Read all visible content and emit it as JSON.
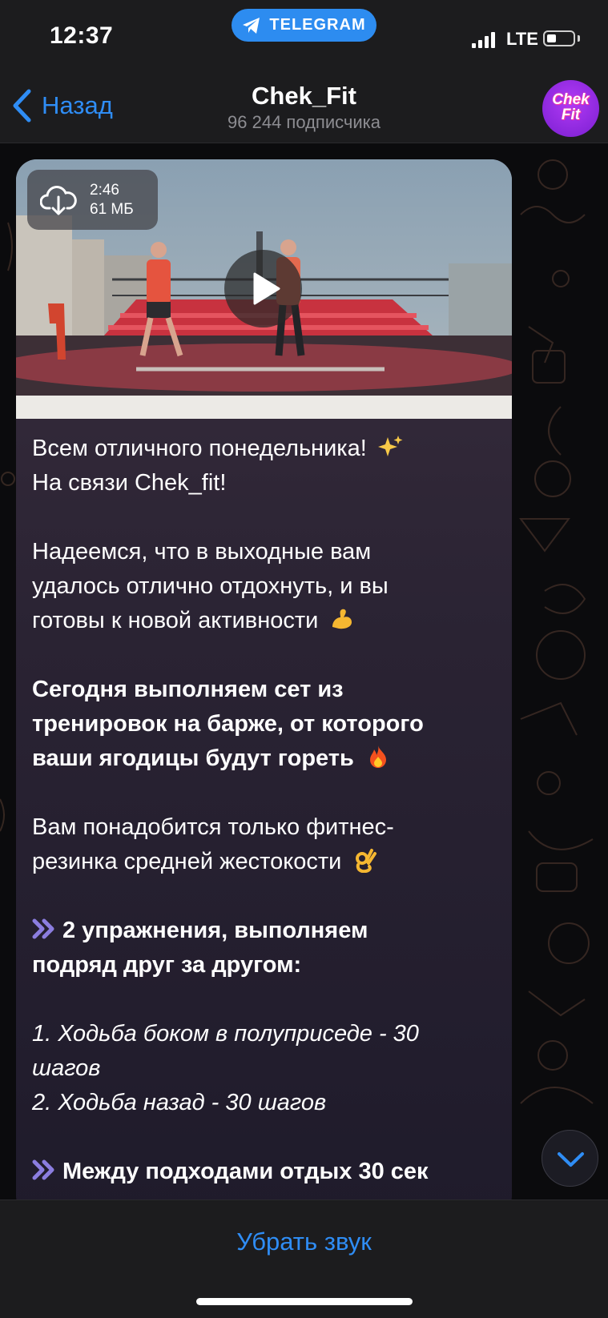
{
  "status_bar": {
    "time": "12:37",
    "app_pill": "TELEGRAM",
    "network": "LTE",
    "battery_level": 0.35
  },
  "header": {
    "back_label": "Назад",
    "title": "Chek_Fit",
    "subscribers": "96 244 подписчика",
    "avatar_text_line1": "Chek",
    "avatar_text_line2": "Fit"
  },
  "video": {
    "duration": "2:46",
    "size": "61 МБ"
  },
  "message": {
    "line1": "Всем отличного понедельника!",
    "line2": "На связи Chek_fit!",
    "p2_line1": "Надеемся, что в выходные вам",
    "p2_line2": "удалось отлично отдохнуть, и вы",
    "p2_line3": "готовы к новой активности",
    "p3_line1": "Сегодня выполняем сет из",
    "p3_line2": "тренировок на барже, от которого",
    "p3_line3": "ваши ягодицы будут гореть",
    "p4_line1": "Вам понадобится только фитнес-",
    "p4_line2": "резинка средней жестокости",
    "p5_line1": "2 упражнения, выполняем",
    "p5_line2": "подряд друг за другом:",
    "p6_line1": "1. Ходьба боком в полуприседе - 30",
    "p6_line2": "шагов",
    "p6_line3": "2. Ходьба назад - 30 шагов",
    "p7_line1": "Между подходами отдых 30 сек"
  },
  "bottom_bar": {
    "mute_label": "Убрать звук"
  },
  "colors": {
    "accent": "#2f8df5",
    "background": "#0b0b0d",
    "bar": "#1c1c1e"
  }
}
